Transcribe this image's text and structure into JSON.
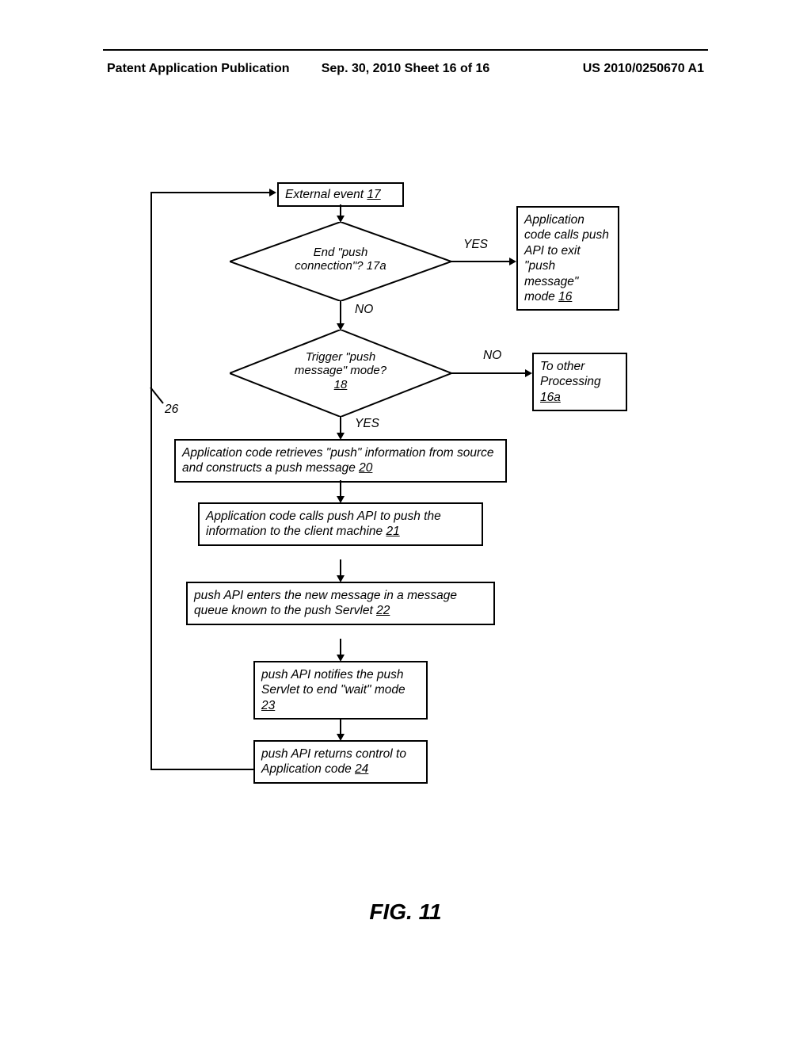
{
  "header": {
    "left": "Patent Application Publication",
    "center": "Sep. 30, 2010   Sheet 16 of 16",
    "right": "US 2010/0250670 A1"
  },
  "figure_label": "FIG. 11",
  "loop_ref": "26",
  "boxes": {
    "b17": {
      "text": "External event ",
      "ref": "17"
    },
    "b16": {
      "text": "Application code calls push API to exit \"push message\" mode  ",
      "ref": "16"
    },
    "b16a": {
      "text": "To other Processing ",
      "ref": "16a"
    },
    "b20": {
      "text": "Application code retrieves \"push\" information from source  and constructs a push message ",
      "ref": "20"
    },
    "b21": {
      "text": "Application code calls push API to  push the information to the client machine ",
      "ref": "21"
    },
    "b22": {
      "text": "push API enters the new message in a message queue known to the push Servlet ",
      "ref": "22"
    },
    "b23": {
      "text": "push API notifies the push Servlet to end \"wait\" mode      ",
      "ref": "23"
    },
    "b24": {
      "text": "push API returns control to Application code ",
      "ref": "24"
    }
  },
  "diamonds": {
    "d17a": {
      "line1": "End \"push",
      "line2": "connection\"? 17a"
    },
    "d18": {
      "line1": "Trigger \"push",
      "line2": "message\" mode?",
      "ref": "18"
    }
  },
  "labels": {
    "yes1": "YES",
    "no1": "NO",
    "yes2": "YES",
    "no2": "NO"
  },
  "chart_data": {
    "type": "flowchart",
    "title": "FIG. 11",
    "nodes": [
      {
        "id": "17",
        "type": "process",
        "text": "External event"
      },
      {
        "id": "17a",
        "type": "decision",
        "text": "End \"push connection\"?"
      },
      {
        "id": "16",
        "type": "process",
        "text": "Application code calls push API to exit \"push message\" mode"
      },
      {
        "id": "18",
        "type": "decision",
        "text": "Trigger \"push message\" mode?"
      },
      {
        "id": "16a",
        "type": "process",
        "text": "To other Processing"
      },
      {
        "id": "20",
        "type": "process",
        "text": "Application code retrieves \"push\" information from source and constructs a push message"
      },
      {
        "id": "21",
        "type": "process",
        "text": "Application code calls push API to push the information to the client machine"
      },
      {
        "id": "22",
        "type": "process",
        "text": "push API enters the new message in a message queue known to the push Servlet"
      },
      {
        "id": "23",
        "type": "process",
        "text": "push API notifies the push Servlet to end \"wait\" mode"
      },
      {
        "id": "24",
        "type": "process",
        "text": "push API returns control to Application code"
      }
    ],
    "edges": [
      {
        "from": "17",
        "to": "17a",
        "label": ""
      },
      {
        "from": "17a",
        "to": "16",
        "label": "YES"
      },
      {
        "from": "17a",
        "to": "18",
        "label": "NO"
      },
      {
        "from": "18",
        "to": "16a",
        "label": "NO"
      },
      {
        "from": "18",
        "to": "20",
        "label": "YES"
      },
      {
        "from": "20",
        "to": "21",
        "label": ""
      },
      {
        "from": "21",
        "to": "22",
        "label": ""
      },
      {
        "from": "22",
        "to": "23",
        "label": ""
      },
      {
        "from": "23",
        "to": "24",
        "label": ""
      },
      {
        "from": "24",
        "to": "17",
        "label": "",
        "loop_ref": "26"
      }
    ]
  }
}
